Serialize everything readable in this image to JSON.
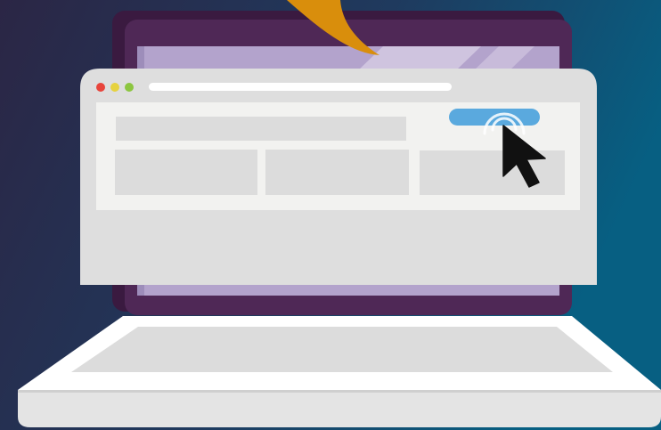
{
  "colors": {
    "background_left": "#2b2645",
    "background_right": "#075f82",
    "screen_bezel": "#4f2856",
    "screen_bezel_shadow": "#3a1a40",
    "screen_glass": "#b3a3cc",
    "browser_frame": "#dedede",
    "browser_page": "#f2f2f0",
    "placeholder_block": "#dcdcdc",
    "url_bar": "#ffffff",
    "dot_close": "#e8443b",
    "dot_minimize": "#e6d23f",
    "dot_maximize": "#8cc640",
    "primary_button": "#5aa9de",
    "cursor": "#111111",
    "keyboard_deck": "#ffffff",
    "keyboard_panel": "#dcdcdc",
    "callout": "#d98e0c"
  },
  "icons": {
    "cursor": "mouse-pointer-icon",
    "click_ripple": "click-ripple-icon",
    "callout": "speech-bubble-tail"
  }
}
